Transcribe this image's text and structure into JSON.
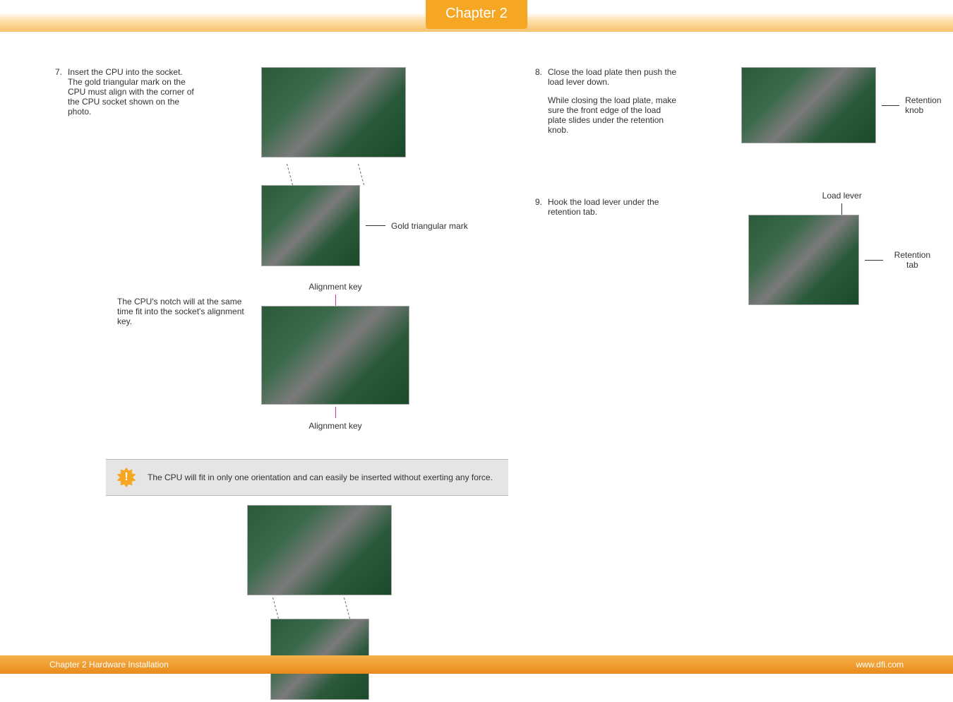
{
  "header": {
    "chapter_tab": "Chapter 2"
  },
  "left": {
    "step7_num": "7.",
    "step7_text": "Insert the CPU into the socket. The gold triangular mark on the CPU must align with the corner of the CPU socket shown on the photo.",
    "gold_mark_label": "Gold triangular mark",
    "alignment_key_top": "Alignment key",
    "alignment_key_bottom": "Alignment key",
    "notch_text": "The CPU's notch will at the same time fit into the socket's alignment key.",
    "note_text": "The CPU will fit in only one orientation and can easily be inserted without exerting any force."
  },
  "right": {
    "step8_num": "8.",
    "step8_text": "Close the load plate then push the load lever down.",
    "step8_sub": "While closing the load plate, make sure the front edge of the load plate slides under the retention knob.",
    "retention_knob_label": "Retention knob",
    "step9_num": "9.",
    "step9_text": "Hook the load lever under the retention tab.",
    "load_lever_label": "Load lever",
    "retention_tab_label": "Retention tab"
  },
  "footer": {
    "left": "Chapter 2 Hardware Installation",
    "right": "www.dfi.com"
  },
  "note_icon_glyph": "!"
}
